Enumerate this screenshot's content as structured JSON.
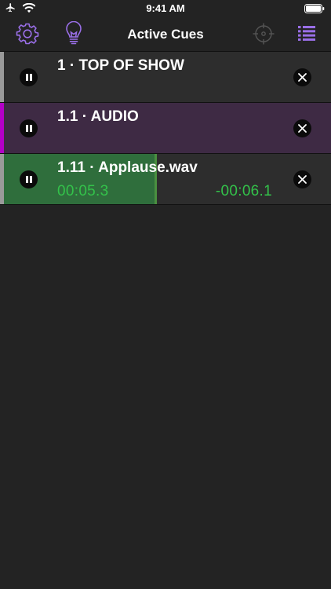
{
  "status_bar": {
    "time": "9:41 AM",
    "left_icons": [
      "airplane-icon",
      "wifi-icon"
    ],
    "right_icons": [
      "battery-icon"
    ]
  },
  "nav": {
    "title": "Active Cues",
    "left_icons": [
      "gear-icon",
      "lightbulb-icon"
    ],
    "right_icons": [
      "target-icon",
      "list-icon"
    ],
    "accent_color": "#9a6fe8",
    "inactive_icon_color": "#555555"
  },
  "cues": [
    {
      "label": "1 · TOP OF SHOW",
      "row_color": "#2d2d2d",
      "bar_color": "#9a9a9a"
    },
    {
      "label": "1.1 · AUDIO",
      "row_color": "#3e2a44",
      "bar_color": "#b400c8"
    },
    {
      "label": "1.11 · Applause.wav",
      "row_color": "#2d2d2d",
      "bar_color": "#9a9a9a",
      "progress": 0.46,
      "progress_color": "#2f6e3c",
      "elapsed": "00:05.3",
      "remaining": "-00:06.1",
      "time_color": "#33c24a"
    }
  ]
}
